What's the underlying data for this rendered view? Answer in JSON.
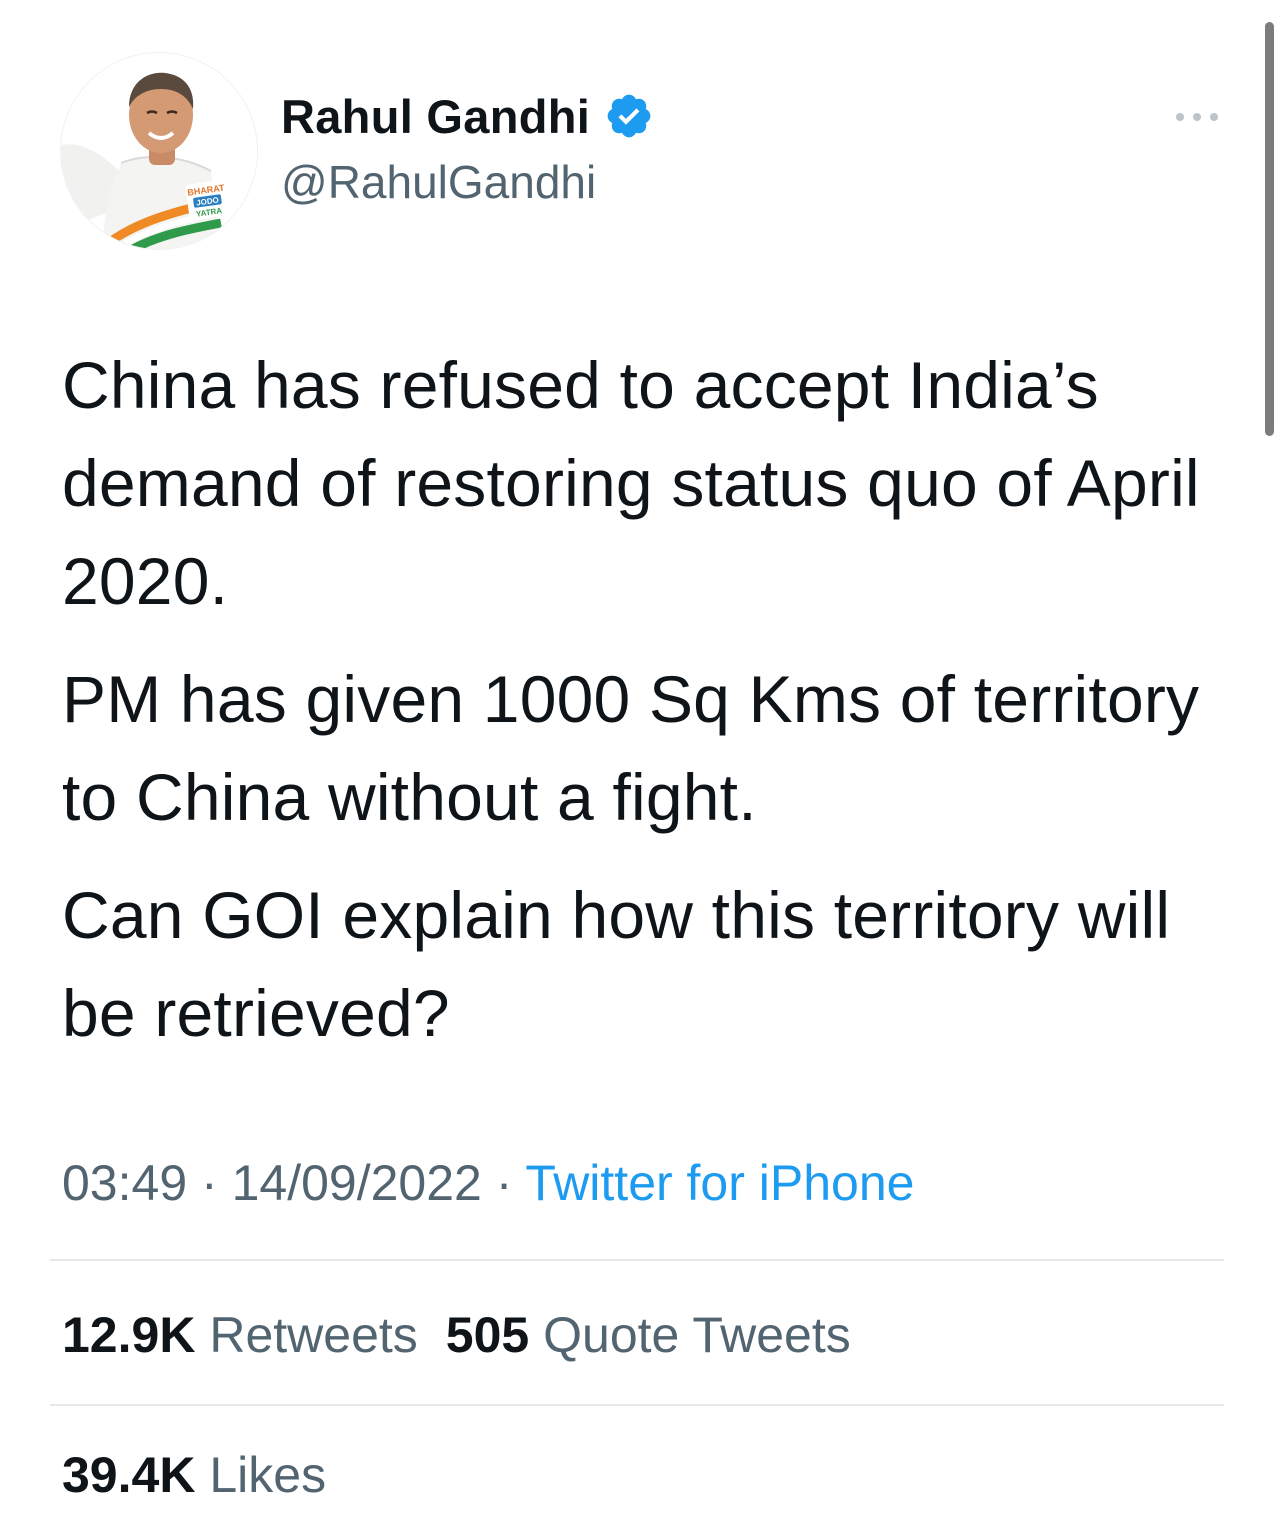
{
  "author": {
    "name": "Rahul Gandhi",
    "handle": "@RahulGandhi",
    "verified": true,
    "avatar_badge_text": "BHARAT JODO YATRA"
  },
  "tweet": {
    "paragraphs": [
      "China has refused to accept India’s demand of restoring status quo of April 2020.",
      "PM has given 1000 Sq Kms of territory to China without a fight.",
      "Can GOI explain how this territory will be retrieved?"
    ],
    "time": "03:49",
    "date": "14/09/2022",
    "separator": "·",
    "source": "Twitter for iPhone"
  },
  "stats": {
    "retweets_count": "12.9K",
    "retweets_label": "Retweets",
    "quotes_count": "505",
    "quotes_label": "Quote Tweets",
    "likes_count": "39.4K",
    "likes_label": "Likes"
  },
  "icons": {
    "verified": "verified-badge-icon",
    "more": "more-options-icon"
  },
  "colors": {
    "text": "#0f1419",
    "secondary": "#536471",
    "link": "#1d9bf0",
    "verified": "#1d9bf0",
    "divider": "#e4e8eb"
  }
}
